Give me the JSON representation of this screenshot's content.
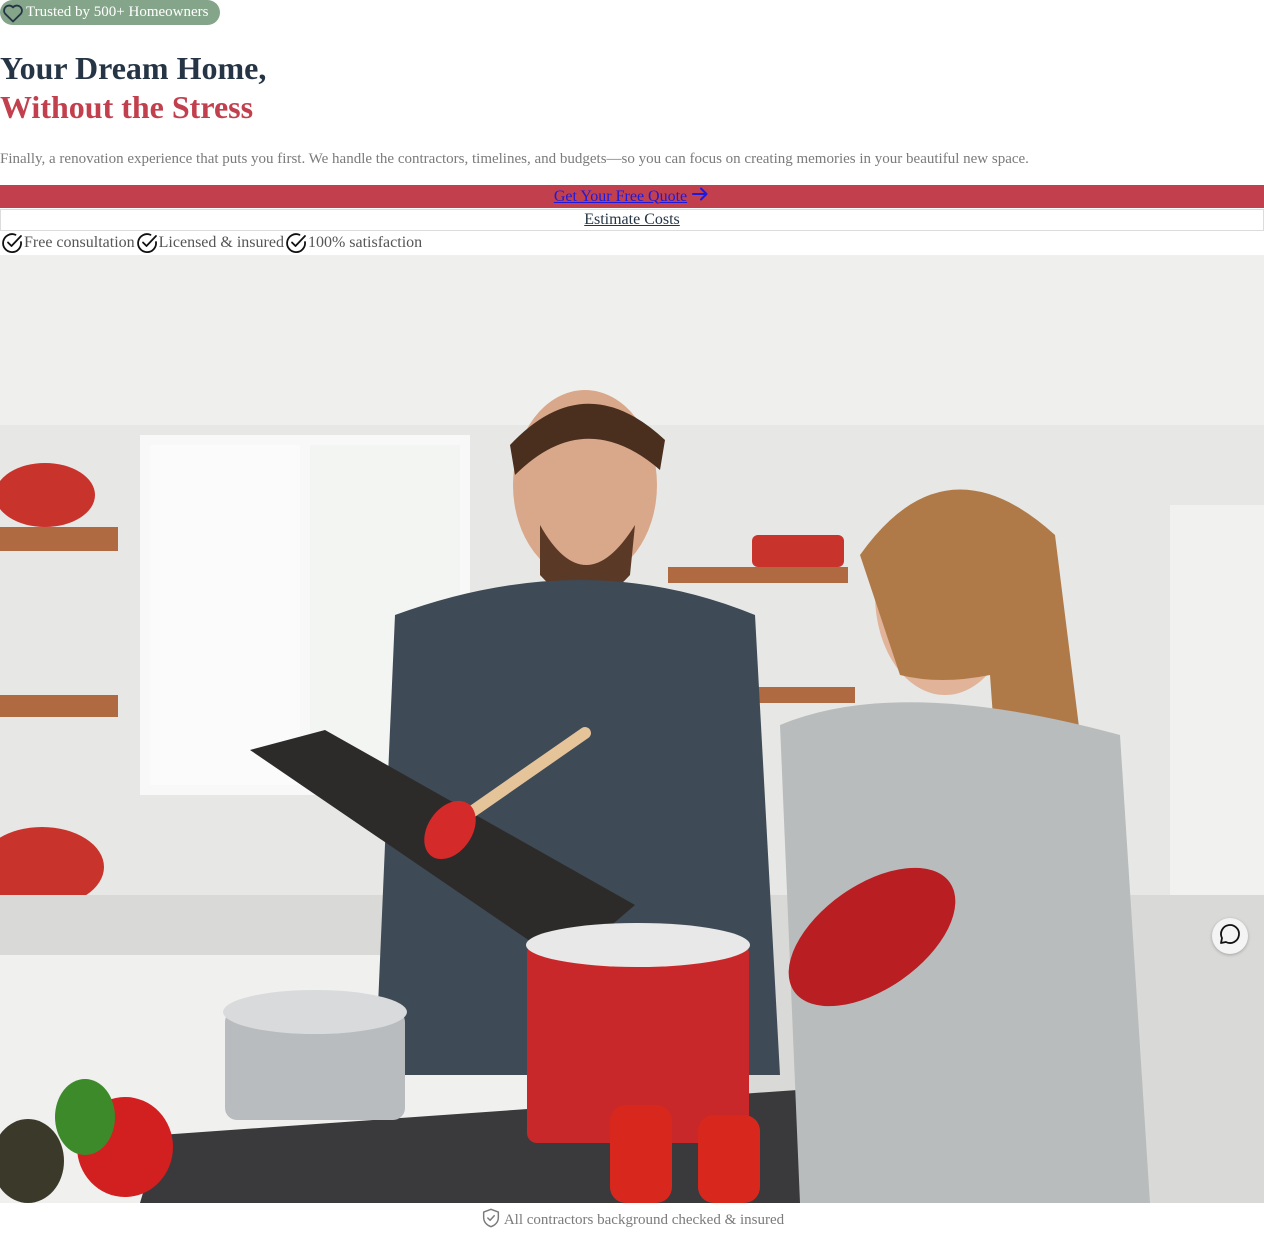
{
  "badge": {
    "icon": "heart-icon",
    "text": "Trusted by 500+ Homeowners"
  },
  "hero": {
    "title_line1": "Your Dream Home,",
    "title_line2": "Without the Stress",
    "subtitle": "Finally, a renovation experience that puts you first. We handle the contractors, timelines, and budgets—so you can focus on creating memories in your beautiful new space."
  },
  "cta": {
    "primary_label": "Get Your Free Quote",
    "primary_icon": "arrow-right-icon",
    "secondary_label": "Estimate Costs"
  },
  "features": [
    {
      "icon": "check-circle-icon",
      "label": "Free consultation"
    },
    {
      "icon": "check-circle-icon",
      "label": "Licensed & insured"
    },
    {
      "icon": "check-circle-icon",
      "label": "100% satisfaction"
    }
  ],
  "hero_image": {
    "description": "Couple cooking together in a bright kitchen with red cookware"
  },
  "chat": {
    "icon": "chat-bubble-icon"
  },
  "footer_note": {
    "icon": "shield-check-icon",
    "text": "All contractors background checked & insured"
  },
  "colors": {
    "accent": "#c2404e",
    "heading": "#263545",
    "badge": "#85a58a",
    "muted_text": "#7b7b7b"
  }
}
